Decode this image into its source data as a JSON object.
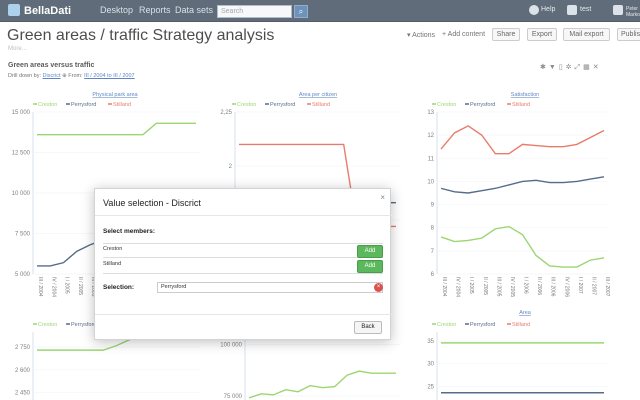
{
  "topbar": {
    "logo": "BellaDati",
    "nav": [
      "Desktop",
      "Reports",
      "Data sets"
    ],
    "search_placeholder": "Search",
    "help": "Help",
    "user": "test",
    "name": "Peter Marko"
  },
  "page": {
    "title": "Green areas / traffic Strategy analysis",
    "more": "More...",
    "actions": "Actions",
    "add_content": "Add content",
    "buttons": [
      "Share",
      "Export",
      "Mail export",
      "Publish"
    ]
  },
  "report": {
    "title": "Green areas versus traffic",
    "drill_prefix": "Drill down by:",
    "drill_attr": "Discrict",
    "from_label": "From:",
    "from_range": "III / 2004 to III / 2007"
  },
  "colors": {
    "creston": "#7ac943",
    "perrysford": "#1f3b63",
    "stilland": "#e0503b"
  },
  "chart_data": [
    {
      "type": "line",
      "title": "Physical park area",
      "legend": [
        "Creston",
        "Perrysford",
        "Stilland"
      ],
      "x": [
        "III / 2004",
        "IV / 2004",
        "I / 2005",
        "II / 2005",
        "III / 2005",
        "IV / 2005",
        "I / 2006",
        "II / 2006",
        "III / 2006",
        "IV / 2006",
        "I / 2007",
        "II / 2007",
        "III / 2007"
      ],
      "ylim": [
        5000,
        15000
      ],
      "yticks": [
        "15 000",
        "12 500",
        "10 000",
        "7 500",
        "5 000"
      ],
      "series": [
        {
          "name": "Creston",
          "values": [
            13600,
            13600,
            13600,
            13600,
            13600,
            13600,
            13600,
            13600,
            13600,
            14300,
            14300,
            14300,
            14300
          ]
        },
        {
          "name": "Perrysford",
          "values": [
            5500,
            5500,
            5700,
            6400,
            6800,
            7100,
            7300,
            7600,
            7800,
            8100,
            8300,
            8500,
            8700
          ]
        }
      ]
    },
    {
      "type": "line",
      "title": "Area per citizen",
      "legend": [
        "Creston",
        "Perrysford",
        "Stilland"
      ],
      "ylim": [
        1.5,
        2.25
      ],
      "yticks": [
        "2,25",
        "2",
        "1,75"
      ],
      "series": [
        {
          "name": "Stilland",
          "values": [
            2.1,
            2.1,
            2.1,
            2.1,
            2.1,
            2.1,
            2.1,
            2.1,
            2.1,
            1.72,
            1.72,
            1.72,
            1.72
          ]
        },
        {
          "name": "Perrysford",
          "values": [
            1.55,
            1.55,
            1.55,
            1.55,
            1.55,
            1.55,
            1.58,
            1.63,
            1.75,
            1.83,
            1.83,
            1.83,
            1.83
          ]
        }
      ]
    },
    {
      "type": "line",
      "title": "Satisfaction",
      "legend": [
        "Creston",
        "Perrysford",
        "Stilland"
      ],
      "x": [
        "III / 2004",
        "IV / 2004",
        "I / 2005",
        "II / 2005",
        "III / 2005",
        "IV / 2005",
        "I / 2006",
        "II / 2006",
        "III / 2006",
        "IV / 2006",
        "I / 2007",
        "II / 2007",
        "III / 2007"
      ],
      "ylim": [
        6,
        13
      ],
      "yticks": [
        "13",
        "12",
        "11",
        "10",
        "9",
        "8",
        "7",
        "6"
      ],
      "series": [
        {
          "name": "Creston",
          "values": [
            7.6,
            7.4,
            7.45,
            7.55,
            7.95,
            8.05,
            7.7,
            6.8,
            6.35,
            6.3,
            6.3,
            6.6,
            6.7
          ]
        },
        {
          "name": "Perrysford",
          "values": [
            9.7,
            9.55,
            9.5,
            9.6,
            9.7,
            9.85,
            10.0,
            10.05,
            9.95,
            9.95,
            10.0,
            10.1,
            10.2
          ]
        },
        {
          "name": "Stilland",
          "values": [
            11.4,
            12.1,
            12.4,
            12.0,
            11.2,
            11.2,
            11.6,
            11.55,
            11.5,
            11.5,
            11.6,
            11.9,
            12.2
          ]
        }
      ]
    },
    {
      "type": "line",
      "title": "",
      "legend": [
        "Creston",
        "Perrysford",
        "Stilland"
      ],
      "ylim": [
        2400,
        2850
      ],
      "yticks": [
        "2 750",
        "2 600",
        "2 450"
      ],
      "series": [
        {
          "name": "Creston",
          "values": [
            2730,
            2730,
            2730,
            2730,
            2730,
            2730,
            2760,
            2800,
            2820,
            2820,
            2820,
            2820,
            2820
          ]
        }
      ]
    },
    {
      "type": "line",
      "title": "",
      "ylim": [
        73000,
        106000
      ],
      "yticks": [
        "100 000",
        "75 000"
      ],
      "series": [
        {
          "name": "Creston",
          "values": [
            74000,
            76000,
            75500,
            78000,
            77000,
            80000,
            79000,
            79500,
            85000,
            87000,
            86000,
            86000,
            86000
          ]
        }
      ]
    },
    {
      "type": "line",
      "title": "Area",
      "legend": [
        "Creston",
        "Perrysford",
        "Stilland"
      ],
      "ylim": [
        22,
        37
      ],
      "yticks": [
        "35",
        "30",
        "25"
      ],
      "series": [
        {
          "name": "Creston",
          "values": [
            34.6,
            34.6,
            34.6,
            34.6,
            34.6,
            34.6,
            34.6,
            34.6,
            34.6,
            34.6,
            34.6,
            34.6,
            34.6
          ]
        },
        {
          "name": "Perrysford",
          "values": [
            23.6,
            23.6,
            23.6,
            23.6,
            23.6,
            23.6,
            23.6,
            23.6,
            23.6,
            23.6,
            23.6,
            23.6,
            23.6
          ]
        }
      ]
    }
  ],
  "dialog": {
    "title": "Value selection - Discrict",
    "close": "×",
    "select_members": "Select members:",
    "members": [
      {
        "name": "Creston",
        "action": "Add"
      },
      {
        "name": "Stilland",
        "action": "Add"
      }
    ],
    "selection_label": "Selection:",
    "selection_value": "Perrysford",
    "remove": "×",
    "back": "Back"
  }
}
